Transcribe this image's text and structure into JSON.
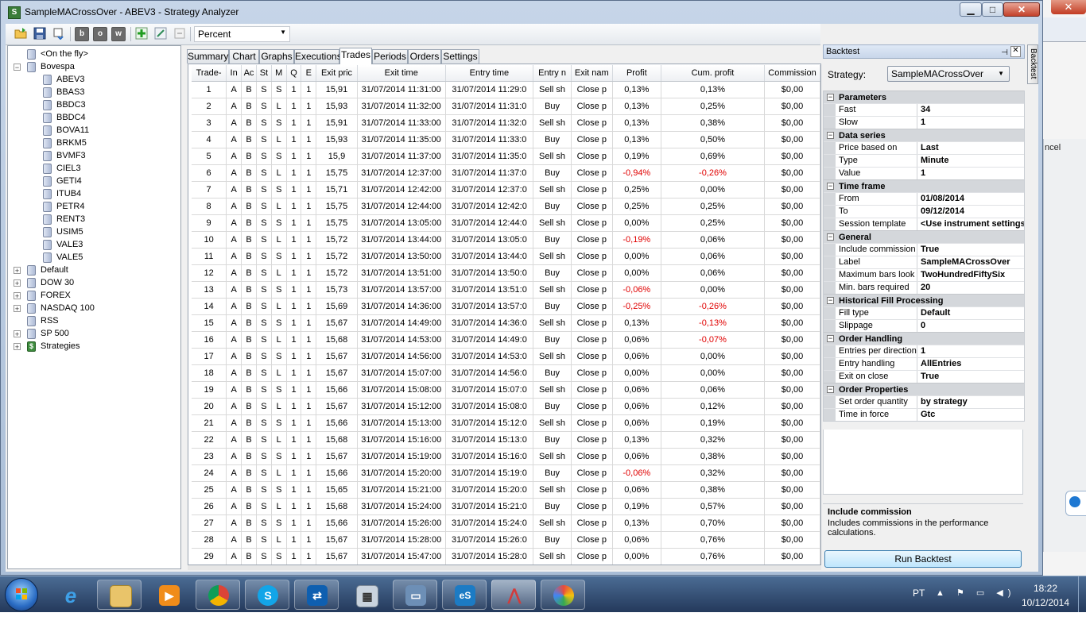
{
  "window": {
    "title": "SampleMACrossOver - ABEV3 - Strategy Analyzer",
    "app_icon_letter": "S",
    "minimize": "▁",
    "maximize": "□",
    "close": "✕"
  },
  "background": {
    "cancel_fragment": "ncel",
    "close_glyph": "✕"
  },
  "toolbar": {
    "buttons": [
      "open-folder-icon",
      "save-icon",
      "export-icon",
      "b",
      "o",
      "w",
      "add-icon",
      "edit-icon",
      "delete-icon"
    ],
    "b_label": "b",
    "o_label": "o",
    "w_label": "w",
    "metric": "Percent",
    "dropdown_arrow": "▼"
  },
  "tree": {
    "on_the_fly": "<On the fly>",
    "bovespa": "Bovespa",
    "bovespa_exp": "−",
    "instruments": [
      "ABEV3",
      "BBAS3",
      "BBDC3",
      "BBDC4",
      "BOVA11",
      "BRKM5",
      "BVMF3",
      "CIEL3",
      "GETI4",
      "ITUB4",
      "PETR4",
      "RENT3",
      "USIM5",
      "VALE3",
      "VALE5"
    ],
    "lists": [
      "Default",
      "DOW 30",
      "FOREX",
      "NASDAQ 100",
      "RSS",
      "SP 500",
      "Strategies"
    ],
    "collapsed_exp": "+"
  },
  "tabs": [
    "Summary",
    "Chart",
    "Graphs",
    "Executions",
    "Trades",
    "Periods",
    "Orders",
    "Settings"
  ],
  "active_tab": "Trades",
  "grid": {
    "columns": [
      "Trade-",
      "In",
      "Ac",
      "St",
      "M",
      "Q",
      "E",
      "Exit pric",
      "Exit time",
      "Entry time",
      "Entry n",
      "Exit nam",
      "Profit",
      "Cum. profit",
      "Commission"
    ],
    "rows": [
      [
        "1",
        "A",
        "B",
        "S",
        "S",
        "1",
        "1",
        "15,91",
        "31/07/2014 11:31:00",
        "31/07/2014 11:29:0",
        "Sell sh",
        "Close p",
        "0,13%",
        "0,13%",
        "$0,00"
      ],
      [
        "2",
        "A",
        "B",
        "S",
        "L",
        "1",
        "1",
        "15,93",
        "31/07/2014 11:32:00",
        "31/07/2014 11:31:0",
        "Buy",
        "Close p",
        "0,13%",
        "0,25%",
        "$0,00"
      ],
      [
        "3",
        "A",
        "B",
        "S",
        "S",
        "1",
        "1",
        "15,91",
        "31/07/2014 11:33:00",
        "31/07/2014 11:32:0",
        "Sell sh",
        "Close p",
        "0,13%",
        "0,38%",
        "$0,00"
      ],
      [
        "4",
        "A",
        "B",
        "S",
        "L",
        "1",
        "1",
        "15,93",
        "31/07/2014 11:35:00",
        "31/07/2014 11:33:0",
        "Buy",
        "Close p",
        "0,13%",
        "0,50%",
        "$0,00"
      ],
      [
        "5",
        "A",
        "B",
        "S",
        "S",
        "1",
        "1",
        "15,9",
        "31/07/2014 11:37:00",
        "31/07/2014 11:35:0",
        "Sell sh",
        "Close p",
        "0,19%",
        "0,69%",
        "$0,00"
      ],
      [
        "6",
        "A",
        "B",
        "S",
        "L",
        "1",
        "1",
        "15,75",
        "31/07/2014 12:37:00",
        "31/07/2014 11:37:0",
        "Buy",
        "Close p",
        "-0,94%",
        "-0,26%",
        "$0,00"
      ],
      [
        "7",
        "A",
        "B",
        "S",
        "S",
        "1",
        "1",
        "15,71",
        "31/07/2014 12:42:00",
        "31/07/2014 12:37:0",
        "Sell sh",
        "Close p",
        "0,25%",
        "0,00%",
        "$0,00"
      ],
      [
        "8",
        "A",
        "B",
        "S",
        "L",
        "1",
        "1",
        "15,75",
        "31/07/2014 12:44:00",
        "31/07/2014 12:42:0",
        "Buy",
        "Close p",
        "0,25%",
        "0,25%",
        "$0,00"
      ],
      [
        "9",
        "A",
        "B",
        "S",
        "S",
        "1",
        "1",
        "15,75",
        "31/07/2014 13:05:00",
        "31/07/2014 12:44:0",
        "Sell sh",
        "Close p",
        "0,00%",
        "0,25%",
        "$0,00"
      ],
      [
        "10",
        "A",
        "B",
        "S",
        "L",
        "1",
        "1",
        "15,72",
        "31/07/2014 13:44:00",
        "31/07/2014 13:05:0",
        "Buy",
        "Close p",
        "-0,19%",
        "0,06%",
        "$0,00"
      ],
      [
        "11",
        "A",
        "B",
        "S",
        "S",
        "1",
        "1",
        "15,72",
        "31/07/2014 13:50:00",
        "31/07/2014 13:44:0",
        "Sell sh",
        "Close p",
        "0,00%",
        "0,06%",
        "$0,00"
      ],
      [
        "12",
        "A",
        "B",
        "S",
        "L",
        "1",
        "1",
        "15,72",
        "31/07/2014 13:51:00",
        "31/07/2014 13:50:0",
        "Buy",
        "Close p",
        "0,00%",
        "0,06%",
        "$0,00"
      ],
      [
        "13",
        "A",
        "B",
        "S",
        "S",
        "1",
        "1",
        "15,73",
        "31/07/2014 13:57:00",
        "31/07/2014 13:51:0",
        "Sell sh",
        "Close p",
        "-0,06%",
        "0,00%",
        "$0,00"
      ],
      [
        "14",
        "A",
        "B",
        "S",
        "L",
        "1",
        "1",
        "15,69",
        "31/07/2014 14:36:00",
        "31/07/2014 13:57:0",
        "Buy",
        "Close p",
        "-0,25%",
        "-0,26%",
        "$0,00"
      ],
      [
        "15",
        "A",
        "B",
        "S",
        "S",
        "1",
        "1",
        "15,67",
        "31/07/2014 14:49:00",
        "31/07/2014 14:36:0",
        "Sell sh",
        "Close p",
        "0,13%",
        "-0,13%",
        "$0,00"
      ],
      [
        "16",
        "A",
        "B",
        "S",
        "L",
        "1",
        "1",
        "15,68",
        "31/07/2014 14:53:00",
        "31/07/2014 14:49:0",
        "Buy",
        "Close p",
        "0,06%",
        "-0,07%",
        "$0,00"
      ],
      [
        "17",
        "A",
        "B",
        "S",
        "S",
        "1",
        "1",
        "15,67",
        "31/07/2014 14:56:00",
        "31/07/2014 14:53:0",
        "Sell sh",
        "Close p",
        "0,06%",
        "0,00%",
        "$0,00"
      ],
      [
        "18",
        "A",
        "B",
        "S",
        "L",
        "1",
        "1",
        "15,67",
        "31/07/2014 15:07:00",
        "31/07/2014 14:56:0",
        "Buy",
        "Close p",
        "0,00%",
        "0,00%",
        "$0,00"
      ],
      [
        "19",
        "A",
        "B",
        "S",
        "S",
        "1",
        "1",
        "15,66",
        "31/07/2014 15:08:00",
        "31/07/2014 15:07:0",
        "Sell sh",
        "Close p",
        "0,06%",
        "0,06%",
        "$0,00"
      ],
      [
        "20",
        "A",
        "B",
        "S",
        "L",
        "1",
        "1",
        "15,67",
        "31/07/2014 15:12:00",
        "31/07/2014 15:08:0",
        "Buy",
        "Close p",
        "0,06%",
        "0,12%",
        "$0,00"
      ],
      [
        "21",
        "A",
        "B",
        "S",
        "S",
        "1",
        "1",
        "15,66",
        "31/07/2014 15:13:00",
        "31/07/2014 15:12:0",
        "Sell sh",
        "Close p",
        "0,06%",
        "0,19%",
        "$0,00"
      ],
      [
        "22",
        "A",
        "B",
        "S",
        "L",
        "1",
        "1",
        "15,68",
        "31/07/2014 15:16:00",
        "31/07/2014 15:13:0",
        "Buy",
        "Close p",
        "0,13%",
        "0,32%",
        "$0,00"
      ],
      [
        "23",
        "A",
        "B",
        "S",
        "S",
        "1",
        "1",
        "15,67",
        "31/07/2014 15:19:00",
        "31/07/2014 15:16:0",
        "Sell sh",
        "Close p",
        "0,06%",
        "0,38%",
        "$0,00"
      ],
      [
        "24",
        "A",
        "B",
        "S",
        "L",
        "1",
        "1",
        "15,66",
        "31/07/2014 15:20:00",
        "31/07/2014 15:19:0",
        "Buy",
        "Close p",
        "-0,06%",
        "0,32%",
        "$0,00"
      ],
      [
        "25",
        "A",
        "B",
        "S",
        "S",
        "1",
        "1",
        "15,65",
        "31/07/2014 15:21:00",
        "31/07/2014 15:20:0",
        "Sell sh",
        "Close p",
        "0,06%",
        "0,38%",
        "$0,00"
      ],
      [
        "26",
        "A",
        "B",
        "S",
        "L",
        "1",
        "1",
        "15,68",
        "31/07/2014 15:24:00",
        "31/07/2014 15:21:0",
        "Buy",
        "Close p",
        "0,19%",
        "0,57%",
        "$0,00"
      ],
      [
        "27",
        "A",
        "B",
        "S",
        "S",
        "1",
        "1",
        "15,66",
        "31/07/2014 15:26:00",
        "31/07/2014 15:24:0",
        "Sell sh",
        "Close p",
        "0,13%",
        "0,70%",
        "$0,00"
      ],
      [
        "28",
        "A",
        "B",
        "S",
        "L",
        "1",
        "1",
        "15,67",
        "31/07/2014 15:28:00",
        "31/07/2014 15:26:0",
        "Buy",
        "Close p",
        "0,06%",
        "0,76%",
        "$0,00"
      ],
      [
        "29",
        "A",
        "B",
        "S",
        "S",
        "1",
        "1",
        "15,67",
        "31/07/2014 15:47:00",
        "31/07/2014 15:28:0",
        "Sell sh",
        "Close p",
        "0,00%",
        "0,76%",
        "$0,00"
      ]
    ],
    "negative_color": "#e00000"
  },
  "backtest": {
    "header": "Backtest",
    "pin": "⊣",
    "close": "✕",
    "strategy_label": "Strategy:",
    "strategy_value": "SampleMACrossOver",
    "dropdown_arrow": "▼",
    "category_exp": "−",
    "categories": [
      {
        "name": "Parameters",
        "rows": [
          [
            "Fast",
            "34"
          ],
          [
            "Slow",
            "1"
          ]
        ]
      },
      {
        "name": "Data series",
        "rows": [
          [
            "Price based on",
            "Last"
          ],
          [
            "Type",
            "Minute"
          ],
          [
            "Value",
            "1"
          ]
        ]
      },
      {
        "name": "Time frame",
        "rows": [
          [
            "From",
            "01/08/2014"
          ],
          [
            "To",
            "09/12/2014"
          ],
          [
            "Session template",
            "<Use instrument settings>"
          ]
        ]
      },
      {
        "name": "General",
        "rows": [
          [
            "Include commission",
            "True"
          ],
          [
            "Label",
            "SampleMACrossOver"
          ],
          [
            "Maximum bars look",
            "TwoHundredFiftySix"
          ],
          [
            "Min. bars required",
            "20"
          ]
        ]
      },
      {
        "name": "Historical Fill Processing",
        "rows": [
          [
            "Fill type",
            "Default"
          ],
          [
            "Slippage",
            "0"
          ]
        ]
      },
      {
        "name": "Order Handling",
        "rows": [
          [
            "Entries per direction",
            "1"
          ],
          [
            "Entry handling",
            "AllEntries"
          ],
          [
            "Exit on close",
            "True"
          ]
        ]
      },
      {
        "name": "Order Properties",
        "rows": [
          [
            "Set order quantity",
            "by strategy"
          ],
          [
            "Time in force",
            "Gtc"
          ]
        ]
      }
    ],
    "help_title": "Include commission",
    "help_text": "Includes commissions in the performance calculations.",
    "run_button": "Run Backtest",
    "side_tab": "Backtest"
  },
  "taskbar": {
    "apps": [
      "windows-explorer",
      "internet-explorer",
      "file-manager",
      "media-player",
      "chrome",
      "skype",
      "teamviewer",
      "calculator",
      "network-computer",
      "es-app",
      "strategy-app",
      "paint"
    ],
    "ie_glyph": "e",
    "skype_glyph": "S",
    "es_glyph": "eS",
    "lang": "PT",
    "tray_icons": "▲ ⚑ ▭ ◀)",
    "time": "18:22",
    "date": "10/12/2014"
  },
  "colors": {
    "accent": "#3c7fb1",
    "negative": "#e00000",
    "title_bar": "#c6d5e8"
  }
}
